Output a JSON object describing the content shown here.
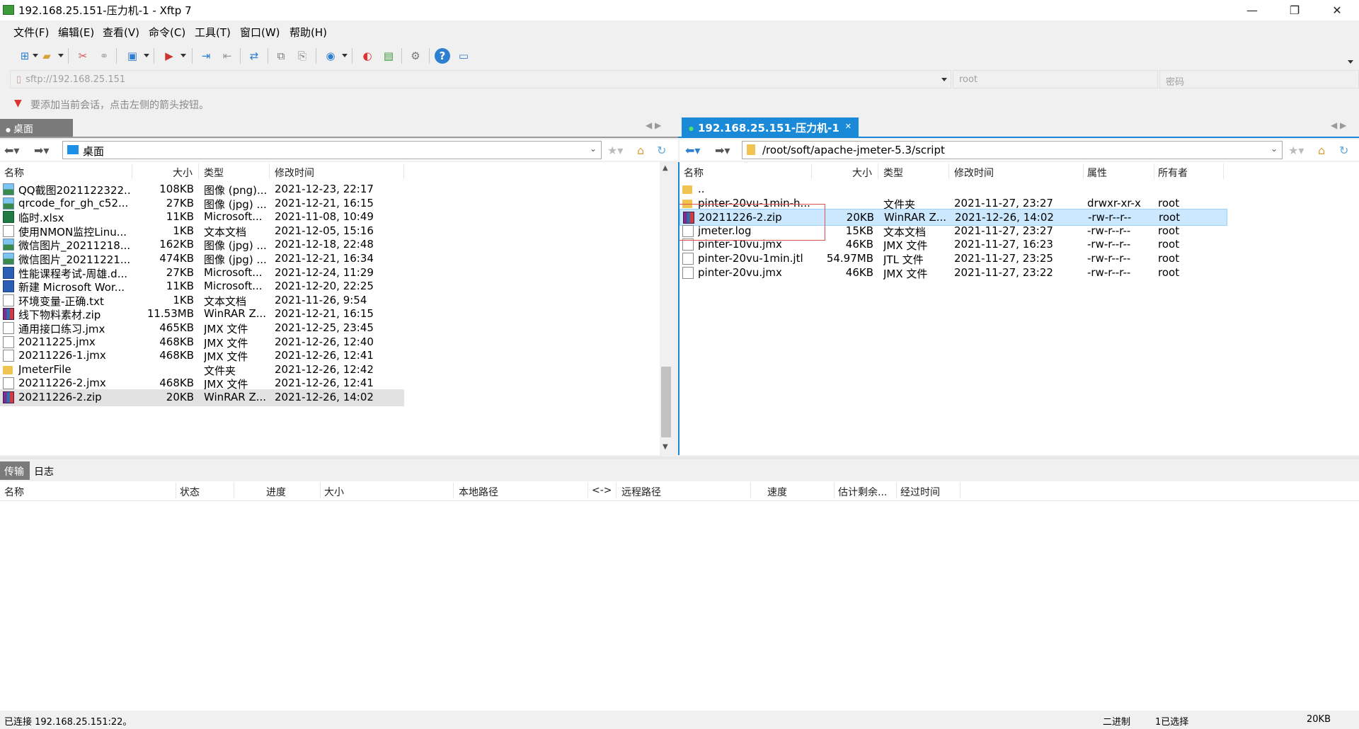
{
  "window": {
    "title": "192.168.25.151-压力机-1 - Xftp 7",
    "minimize": "—",
    "maximize": "❐",
    "close": "✕"
  },
  "menu": [
    "文件(F)",
    "编辑(E)",
    "查看(V)",
    "命令(C)",
    "工具(T)",
    "窗口(W)",
    "帮助(H)"
  ],
  "address": {
    "url": "sftp://192.168.25.151",
    "user": "root",
    "password_placeholder": "密码"
  },
  "hint": "要添加当前会话，点击左侧的箭头按钮。",
  "tabs": {
    "local": "桌面",
    "remote": "192.168.25.151-压力机-1"
  },
  "local": {
    "path": "桌面",
    "columns": [
      "名称",
      "大小",
      "类型",
      "修改时间"
    ],
    "files": [
      {
        "name": "QQ截图2021122322...",
        "size": "108KB",
        "type": "图像 (png)...",
        "mtime": "2021-12-23, 22:17",
        "icon": "image"
      },
      {
        "name": "qrcode_for_gh_c52...",
        "size": "27KB",
        "type": "图像 (jpg) ...",
        "mtime": "2021-12-21, 16:15",
        "icon": "image"
      },
      {
        "name": "临时.xlsx",
        "size": "11KB",
        "type": "Microsoft...",
        "mtime": "2021-11-08, 10:49",
        "icon": "excel"
      },
      {
        "name": "使用NMON监控Linu...",
        "size": "1KB",
        "type": "文本文档",
        "mtime": "2021-12-05, 15:16",
        "icon": "text"
      },
      {
        "name": "微信图片_20211218...",
        "size": "162KB",
        "type": "图像 (jpg) ...",
        "mtime": "2021-12-18, 22:48",
        "icon": "image"
      },
      {
        "name": "微信图片_20211221...",
        "size": "474KB",
        "type": "图像 (jpg) ...",
        "mtime": "2021-12-21, 16:34",
        "icon": "image"
      },
      {
        "name": "性能课程考试-周雄.d...",
        "size": "27KB",
        "type": "Microsoft...",
        "mtime": "2021-12-24, 11:29",
        "icon": "word"
      },
      {
        "name": "新建 Microsoft Wor...",
        "size": "11KB",
        "type": "Microsoft...",
        "mtime": "2021-12-20, 22:25",
        "icon": "word"
      },
      {
        "name": "环境变量-正确.txt",
        "size": "1KB",
        "type": "文本文档",
        "mtime": "2021-11-26, 9:54",
        "icon": "text"
      },
      {
        "name": "线下物料素材.zip",
        "size": "11.53MB",
        "type": "WinRAR Z...",
        "mtime": "2021-12-21, 16:15",
        "icon": "rar"
      },
      {
        "name": "通用接口练习.jmx",
        "size": "465KB",
        "type": "JMX 文件",
        "mtime": "2021-12-25, 23:45",
        "icon": "blank"
      },
      {
        "name": "20211225.jmx",
        "size": "468KB",
        "type": "JMX 文件",
        "mtime": "2021-12-26, 12:40",
        "icon": "blank"
      },
      {
        "name": "20211226-1.jmx",
        "size": "468KB",
        "type": "JMX 文件",
        "mtime": "2021-12-26, 12:41",
        "icon": "blank"
      },
      {
        "name": "JmeterFile",
        "size": "",
        "type": "文件夹",
        "mtime": "2021-12-26, 12:42",
        "icon": "folder"
      },
      {
        "name": "20211226-2.jmx",
        "size": "468KB",
        "type": "JMX 文件",
        "mtime": "2021-12-26, 12:41",
        "icon": "blank"
      },
      {
        "name": "20211226-2.zip",
        "size": "20KB",
        "type": "WinRAR Z...",
        "mtime": "2021-12-26, 14:02",
        "icon": "rar"
      }
    ]
  },
  "remote": {
    "path": "/root/soft/apache-jmeter-5.3/script",
    "columns": [
      "名称",
      "大小",
      "类型",
      "修改时间",
      "属性",
      "所有者"
    ],
    "files": [
      {
        "name": "..",
        "size": "",
        "type": "",
        "mtime": "",
        "attr": "",
        "owner": "",
        "icon": "folder"
      },
      {
        "name": "pinter-20vu-1min-h...",
        "size": "",
        "type": "文件夹",
        "mtime": "2021-11-27, 23:27",
        "attr": "drwxr-xr-x",
        "owner": "root",
        "icon": "folder"
      },
      {
        "name": "20211226-2.zip",
        "size": "20KB",
        "type": "WinRAR Z...",
        "mtime": "2021-12-26, 14:02",
        "attr": "-rw-r--r--",
        "owner": "root",
        "icon": "rar"
      },
      {
        "name": "jmeter.log",
        "size": "15KB",
        "type": "文本文档",
        "mtime": "2021-11-27, 23:27",
        "attr": "-rw-r--r--",
        "owner": "root",
        "icon": "text"
      },
      {
        "name": "pinter-10vu.jmx",
        "size": "46KB",
        "type": "JMX 文件",
        "mtime": "2021-11-27, 16:23",
        "attr": "-rw-r--r--",
        "owner": "root",
        "icon": "blank"
      },
      {
        "name": "pinter-20vu-1min.jtl",
        "size": "54.97MB",
        "type": "JTL 文件",
        "mtime": "2021-11-27, 23:25",
        "attr": "-rw-r--r--",
        "owner": "root",
        "icon": "blank"
      },
      {
        "name": "pinter-20vu.jmx",
        "size": "46KB",
        "type": "JMX 文件",
        "mtime": "2021-11-27, 23:22",
        "attr": "-rw-r--r--",
        "owner": "root",
        "icon": "blank"
      }
    ]
  },
  "transfer": {
    "tabs": [
      "传输",
      "日志"
    ],
    "columns": [
      "名称",
      "状态",
      "进度",
      "大小",
      "本地路径",
      "<->",
      "远程路径",
      "速度",
      "估计剩余...",
      "经过时间"
    ]
  },
  "status": {
    "connection": "已连接 192.168.25.151:22。",
    "mode": "二进制",
    "selected": "1已选择",
    "size": "20KB"
  }
}
